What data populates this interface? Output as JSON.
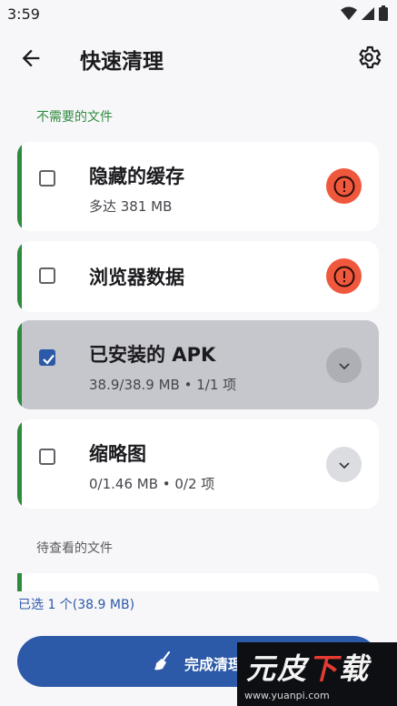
{
  "status": {
    "time": "3:59"
  },
  "header": {
    "title": "快速清理"
  },
  "sections": {
    "unneeded_label": "不需要的文件",
    "review_label": "待查看的文件"
  },
  "items": [
    {
      "title": "隐藏的缓存",
      "subtitle": "多达 381 MB",
      "checked": false,
      "action": "warning-icon"
    },
    {
      "title": "浏览器数据",
      "subtitle": "",
      "checked": false,
      "action": "warning-icon"
    },
    {
      "title": "已安装的 APK",
      "subtitle": "38.9/38.9 MB • 1/1 项",
      "checked": true,
      "action": "chevron-down-icon"
    },
    {
      "title": "缩略图",
      "subtitle": "0/1.46 MB • 0/2 项",
      "checked": false,
      "action": "chevron-down-icon"
    }
  ],
  "footer": {
    "selection_summary": "已选 1 个(38.9 MB)",
    "finish_label": "完成清理"
  },
  "watermark": {
    "text": "元皮下载",
    "url": "www.yuanpi.com"
  },
  "colors": {
    "accent_green": "#2e8b3e",
    "primary_blue": "#2c59a8",
    "warning_red": "#f0583e",
    "selected_card": "#c6c7cc"
  }
}
